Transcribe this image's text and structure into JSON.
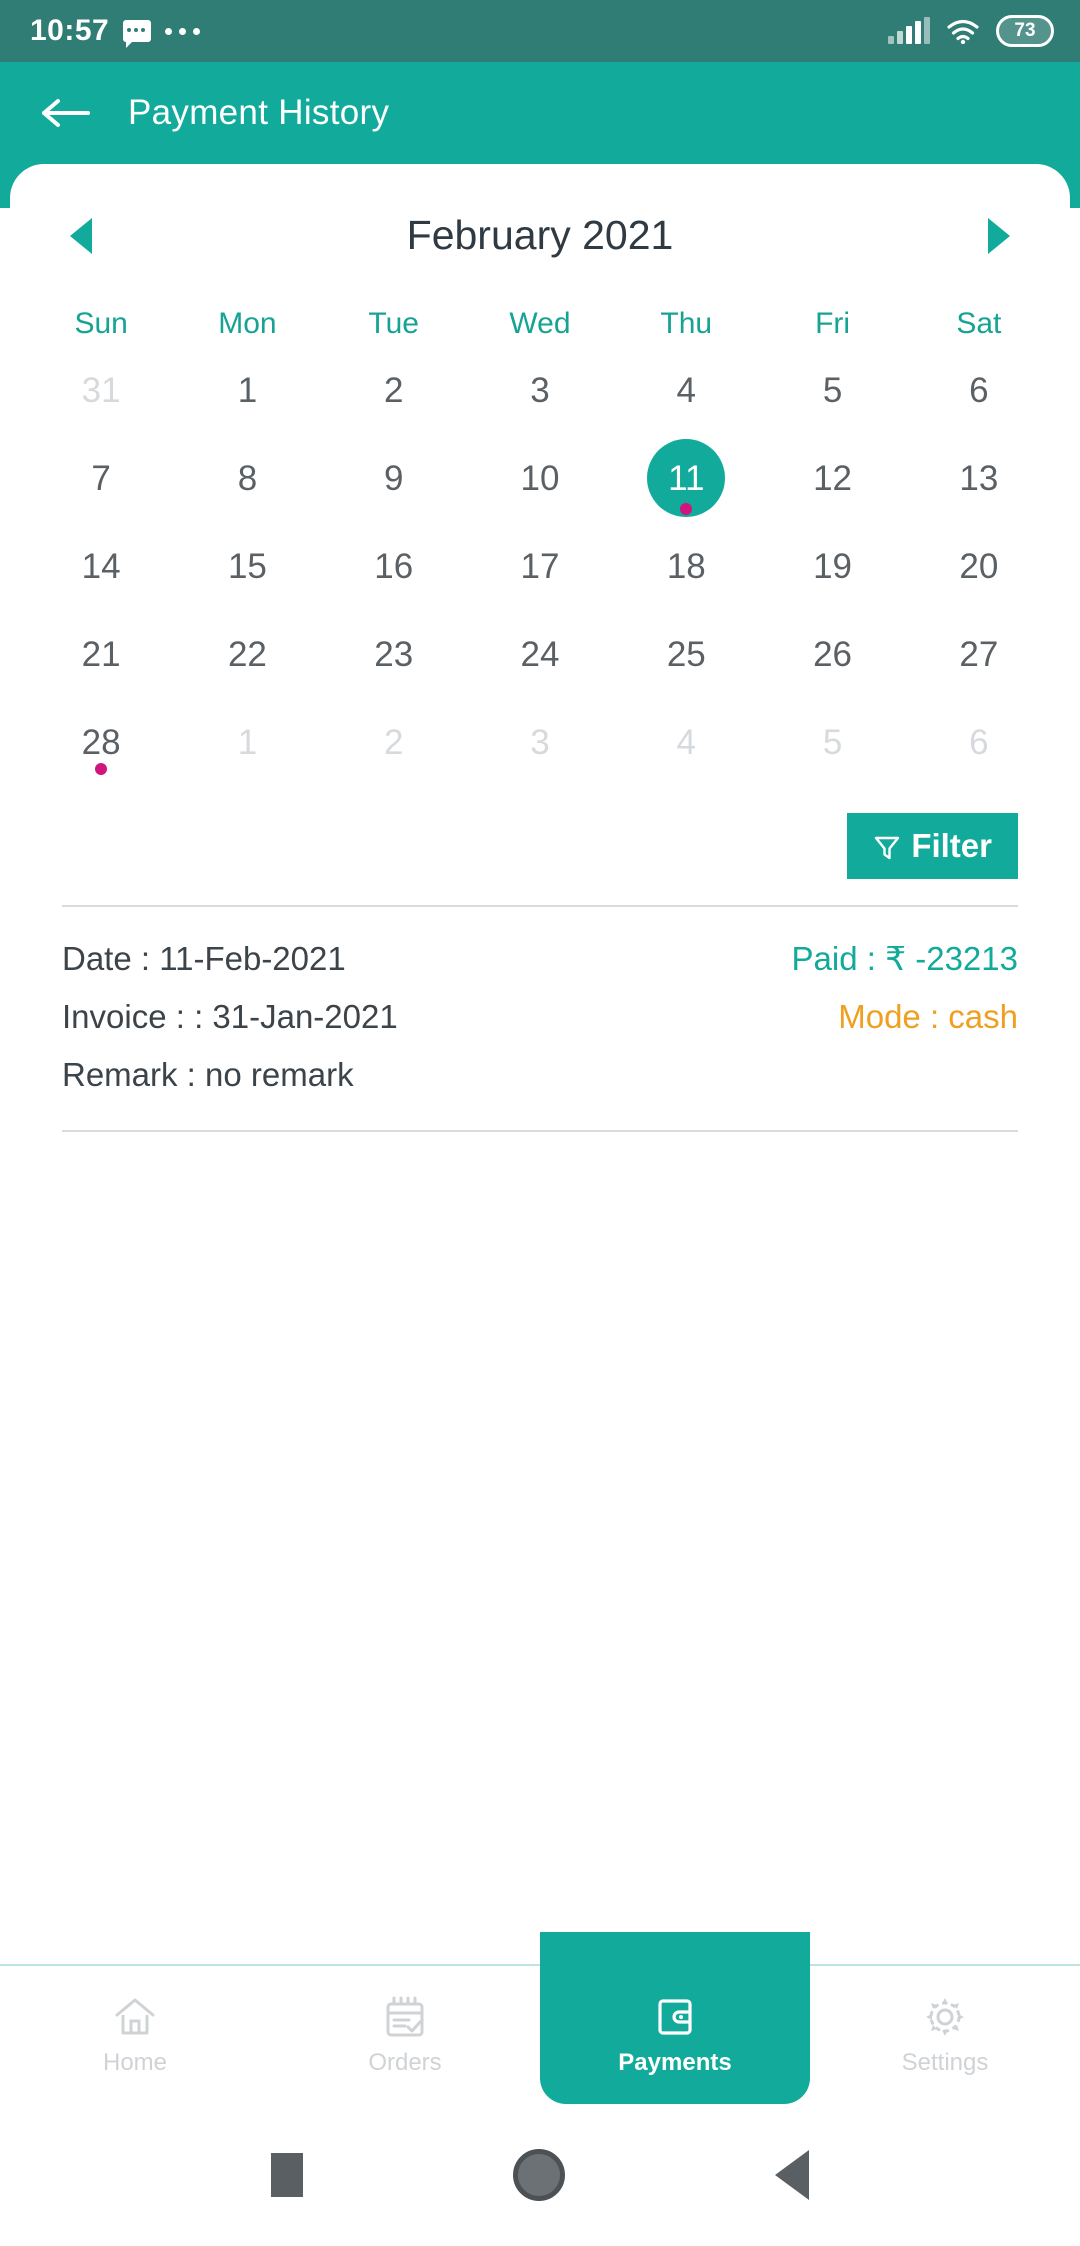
{
  "status_bar": {
    "time": "10:57",
    "battery_level": "73",
    "icons": [
      "message-icon",
      "more-dots-icon",
      "signal-icon",
      "wifi-icon",
      "battery-icon"
    ]
  },
  "app_bar": {
    "title": "Payment History",
    "back_icon": "back-arrow-icon"
  },
  "calendar": {
    "month_title": "February 2021",
    "prev_label": "◀",
    "next_label": "▶",
    "weekdays": [
      "Sun",
      "Mon",
      "Tue",
      "Wed",
      "Thu",
      "Fri",
      "Sat"
    ],
    "weeks": [
      [
        {
          "d": "31",
          "muted": true,
          "selected": false,
          "dot": false
        },
        {
          "d": "1",
          "muted": false,
          "selected": false,
          "dot": false
        },
        {
          "d": "2",
          "muted": false,
          "selected": false,
          "dot": false
        },
        {
          "d": "3",
          "muted": false,
          "selected": false,
          "dot": false
        },
        {
          "d": "4",
          "muted": false,
          "selected": false,
          "dot": false
        },
        {
          "d": "5",
          "muted": false,
          "selected": false,
          "dot": false
        },
        {
          "d": "6",
          "muted": false,
          "selected": false,
          "dot": false
        }
      ],
      [
        {
          "d": "7",
          "muted": false,
          "selected": false,
          "dot": false
        },
        {
          "d": "8",
          "muted": false,
          "selected": false,
          "dot": false
        },
        {
          "d": "9",
          "muted": false,
          "selected": false,
          "dot": false
        },
        {
          "d": "10",
          "muted": false,
          "selected": false,
          "dot": false
        },
        {
          "d": "11",
          "muted": false,
          "selected": true,
          "dot": true
        },
        {
          "d": "12",
          "muted": false,
          "selected": false,
          "dot": false
        },
        {
          "d": "13",
          "muted": false,
          "selected": false,
          "dot": false
        }
      ],
      [
        {
          "d": "14",
          "muted": false,
          "selected": false,
          "dot": false
        },
        {
          "d": "15",
          "muted": false,
          "selected": false,
          "dot": false
        },
        {
          "d": "16",
          "muted": false,
          "selected": false,
          "dot": false
        },
        {
          "d": "17",
          "muted": false,
          "selected": false,
          "dot": false
        },
        {
          "d": "18",
          "muted": false,
          "selected": false,
          "dot": false
        },
        {
          "d": "19",
          "muted": false,
          "selected": false,
          "dot": false
        },
        {
          "d": "20",
          "muted": false,
          "selected": false,
          "dot": false
        }
      ],
      [
        {
          "d": "21",
          "muted": false,
          "selected": false,
          "dot": false
        },
        {
          "d": "22",
          "muted": false,
          "selected": false,
          "dot": false
        },
        {
          "d": "23",
          "muted": false,
          "selected": false,
          "dot": false
        },
        {
          "d": "24",
          "muted": false,
          "selected": false,
          "dot": false
        },
        {
          "d": "25",
          "muted": false,
          "selected": false,
          "dot": false
        },
        {
          "d": "26",
          "muted": false,
          "selected": false,
          "dot": false
        },
        {
          "d": "27",
          "muted": false,
          "selected": false,
          "dot": false
        }
      ],
      [
        {
          "d": "28",
          "muted": false,
          "selected": false,
          "dot": true
        },
        {
          "d": "1",
          "muted": true,
          "selected": false,
          "dot": false
        },
        {
          "d": "2",
          "muted": true,
          "selected": false,
          "dot": false
        },
        {
          "d": "3",
          "muted": true,
          "selected": false,
          "dot": false
        },
        {
          "d": "4",
          "muted": true,
          "selected": false,
          "dot": false
        },
        {
          "d": "5",
          "muted": true,
          "selected": false,
          "dot": false
        },
        {
          "d": "6",
          "muted": true,
          "selected": false,
          "dot": false
        }
      ]
    ]
  },
  "filter": {
    "label": "Filter",
    "icon": "funnel-icon"
  },
  "payment_record": {
    "date": "Date : 11-Feb-2021",
    "paid": "Paid : ₹ -23213",
    "invoice": "Invoice :  : 31-Jan-2021",
    "mode": "Mode : cash",
    "remark": "Remark : no remark"
  },
  "bottom_nav": {
    "items": [
      {
        "label": "Home",
        "icon": "home-icon",
        "active": false
      },
      {
        "label": "Orders",
        "icon": "orders-icon",
        "active": false
      },
      {
        "label": "Payments",
        "icon": "wallet-icon",
        "active": true
      },
      {
        "label": "Settings",
        "icon": "gear-icon",
        "active": false
      }
    ]
  },
  "android_nav": {
    "recent": "recent-apps-button",
    "home": "home-button",
    "back": "back-button"
  },
  "colors": {
    "status_bar": "#2f7d74",
    "accent": "#12aa9a",
    "event_dot": "#d1147e",
    "mode_text": "#efa020"
  }
}
